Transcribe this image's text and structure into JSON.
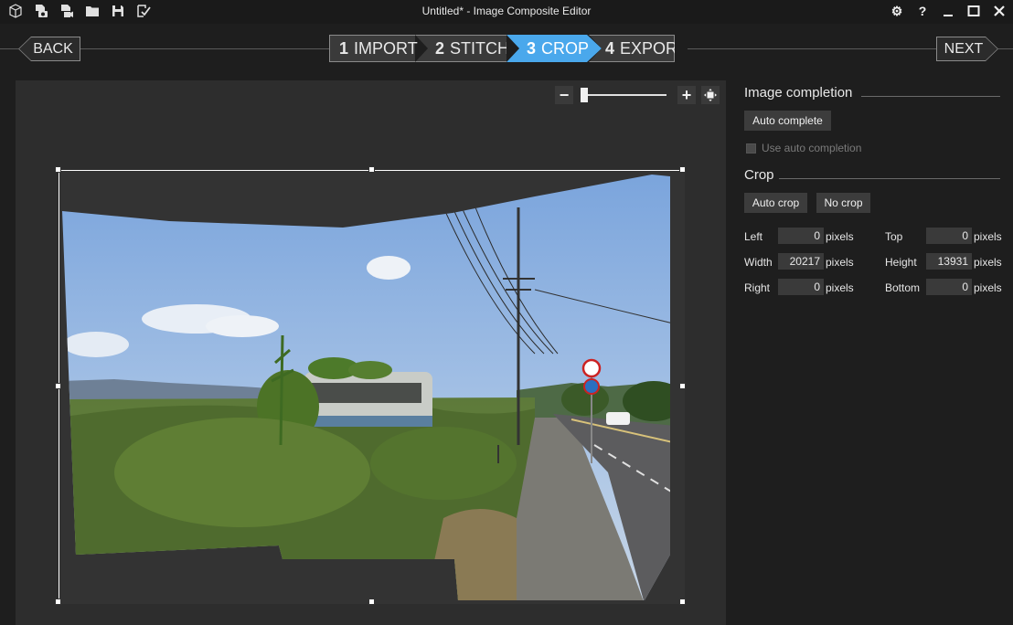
{
  "window": {
    "title": "Untitled* - Image Composite Editor"
  },
  "toolbar": {
    "icons": [
      "cube-icon",
      "new-panorama-from-images-icon",
      "new-panorama-from-video-icon",
      "open-folder-icon",
      "save-icon",
      "export-icon"
    ]
  },
  "window_controls": {
    "settings": "⚙",
    "help": "?",
    "minimize": "_",
    "maximize": "□",
    "close": "✕"
  },
  "nav": {
    "back": "BACK",
    "next": "NEXT"
  },
  "steps": [
    {
      "num": "1",
      "label": "IMPORT",
      "active": false
    },
    {
      "num": "2",
      "label": "STITCH",
      "active": false
    },
    {
      "num": "3",
      "label": "CROP",
      "active": true
    },
    {
      "num": "4",
      "label": "EXPORT",
      "active": false
    }
  ],
  "zoom": {
    "minus": "−",
    "plus": "+",
    "level": 0.05
  },
  "image_completion": {
    "title": "Image completion",
    "auto_complete": "Auto complete",
    "use_auto_completion": "Use auto completion"
  },
  "crop": {
    "title": "Crop",
    "auto_crop": "Auto crop",
    "no_crop": "No crop",
    "fields": {
      "left": {
        "label": "Left",
        "value": "0",
        "unit": "pixels"
      },
      "top": {
        "label": "Top",
        "value": "0",
        "unit": "pixels"
      },
      "width": {
        "label": "Width",
        "value": "20217",
        "unit": "pixels"
      },
      "height": {
        "label": "Height",
        "value": "13931",
        "unit": "pixels"
      },
      "right": {
        "label": "Right",
        "value": "0",
        "unit": "pixels"
      },
      "bottom": {
        "label": "Bottom",
        "value": "0",
        "unit": "pixels"
      }
    }
  },
  "colors": {
    "accent": "#4aa8ec",
    "background": "#1e1e1e",
    "canvas": "#2d2d2d"
  }
}
